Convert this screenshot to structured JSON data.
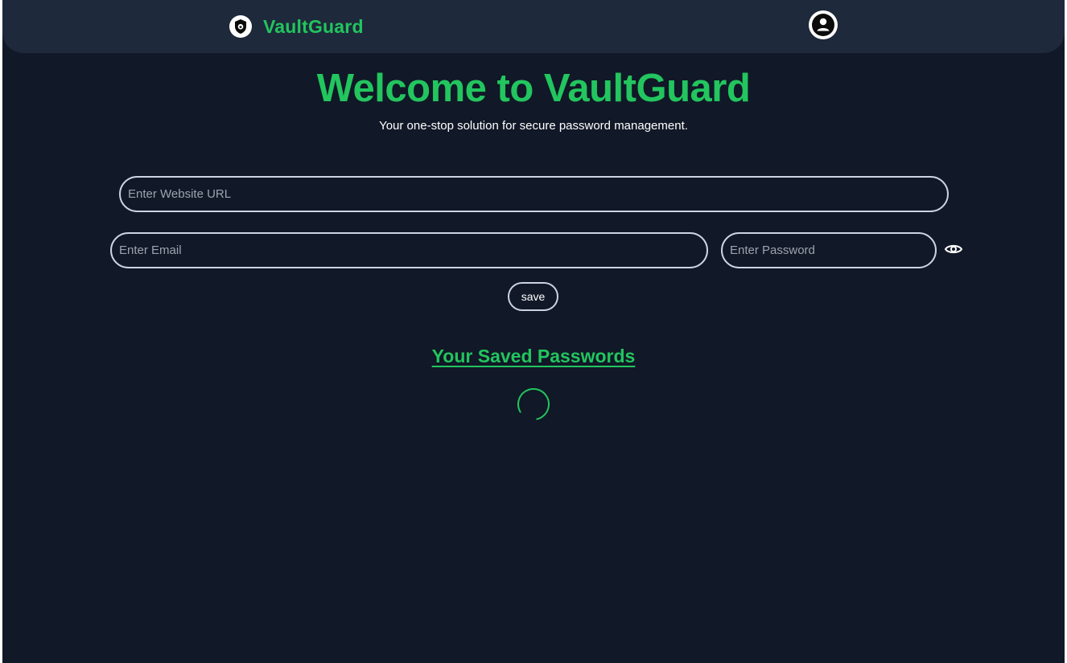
{
  "navbar": {
    "brand_name": "VaultGuard",
    "logo_icon": "shield-lock-icon",
    "profile_icon": "user-circle-icon"
  },
  "hero": {
    "title": "Welcome to VaultGuard",
    "subtitle": "Your one-stop solution for secure password management."
  },
  "form": {
    "url_placeholder": "Enter Website URL",
    "url_value": "",
    "email_placeholder": "Enter Email",
    "email_value": "",
    "password_placeholder": "Enter Password",
    "password_value": "",
    "show_password_icon": "eye-icon",
    "save_label": "save"
  },
  "saved": {
    "heading": "Your Saved Passwords",
    "loading_icon": "loading-spinner-icon"
  },
  "colors": {
    "background": "#111827",
    "navbar": "#1e293b",
    "accent": "#22c55e",
    "text": "#ffffff",
    "border": "#cbd5e1"
  }
}
